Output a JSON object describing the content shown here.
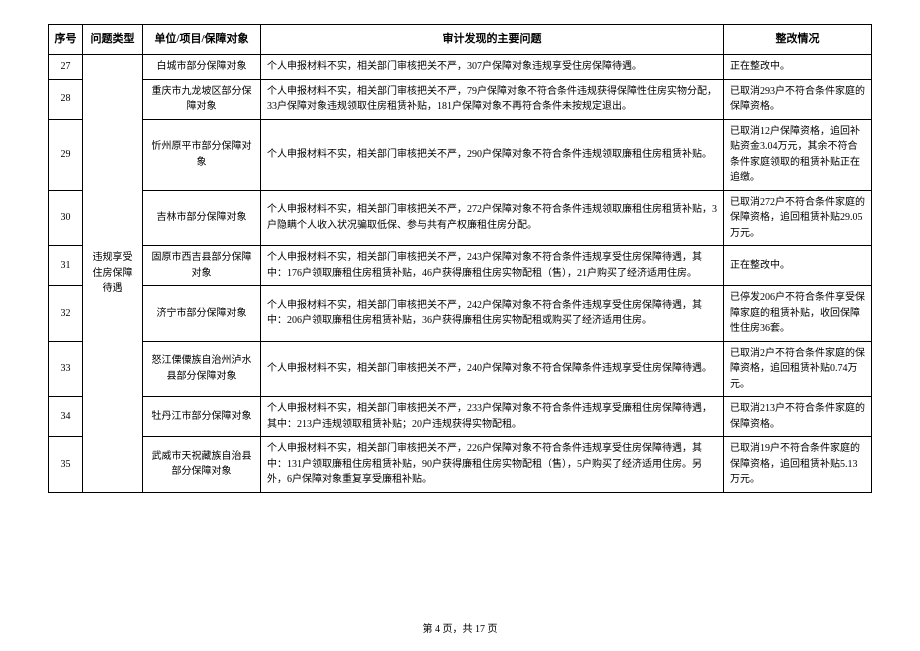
{
  "headers": {
    "seq": "序号",
    "category": "问题类型",
    "unit": "单位/项目/保障对象",
    "issue": "审计发现的主要问题",
    "status": "整改情况"
  },
  "category": "违规享受住房保障待遇",
  "rows": [
    {
      "seq": "27",
      "unit": "白城市部分保障对象",
      "issue": "个人申报材料不实，相关部门审核把关不严，307户保障对象违规享受住房保障待遇。",
      "status": "正在整改中。"
    },
    {
      "seq": "28",
      "unit": "重庆市九龙坡区部分保障对象",
      "issue": "个人申报材料不实，相关部门审核把关不严，79户保障对象不符合条件违规获得保障性住房实物分配，33户保障对象违规领取住房租赁补贴，181户保障对象不再符合条件未按规定退出。",
      "status": "已取消293户不符合条件家庭的保障资格。"
    },
    {
      "seq": "29",
      "unit": "忻州原平市部分保障对象",
      "issue": "个人申报材料不实，相关部门审核把关不严，290户保障对象不符合条件违规领取廉租住房租赁补贴。",
      "status": "已取消12户保障资格，追回补贴资金3.04万元，其余不符合条件家庭领取的租赁补贴正在追缴。"
    },
    {
      "seq": "30",
      "unit": "吉林市部分保障对象",
      "issue": "个人申报材料不实，相关部门审核把关不严，272户保障对象不符合条件违规领取廉租住房租赁补贴，3户隐瞒个人收入状况骗取低保、参与共有产权廉租住房分配。",
      "status": "已取消272户不符合条件家庭的保障资格，追回租赁补贴29.05万元。"
    },
    {
      "seq": "31",
      "unit": "固原市西吉县部分保障对象",
      "issue": "个人申报材料不实，相关部门审核把关不严，243户保障对象不符合条件违规享受住房保障待遇，其中：176户领取廉租住房租赁补贴，46户获得廉租住房实物配租（售），21户购买了经济适用住房。",
      "status": "正在整改中。"
    },
    {
      "seq": "32",
      "unit": "济宁市部分保障对象",
      "issue": "个人申报材料不实，相关部门审核把关不严，242户保障对象不符合条件违规享受住房保障待遇，其中：206户领取廉租住房租赁补贴，36户获得廉租住房实物配租或购买了经济适用住房。",
      "status": "已停发206户不符合条件享受保障家庭的租赁补贴，收回保障性住房36套。"
    },
    {
      "seq": "33",
      "unit": "怒江傈僳族自治州泸水县部分保障对象",
      "issue": "个人申报材料不实，相关部门审核把关不严，240户保障对象不符合保障条件违规享受住房保障待遇。",
      "status": "已取消2户不符合条件家庭的保障资格，追回租赁补贴0.74万元。"
    },
    {
      "seq": "34",
      "unit": "牡丹江市部分保障对象",
      "issue": "个人申报材料不实，相关部门审核把关不严，233户保障对象不符合条件违规享受廉租住房保障待遇，其中：213户违规领取租赁补贴；20户违规获得实物配租。",
      "status": "已取消213户不符合条件家庭的保障资格。"
    },
    {
      "seq": "35",
      "unit": "武威市天祝藏族自治县部分保障对象",
      "issue": "个人申报材料不实，相关部门审核把关不严，226户保障对象不符合条件违规享受住房保障待遇，其中：131户领取廉租住房租赁补贴，90户获得廉租住房实物配租（售），5户购买了经济适用住房。另外，6户保障对象重复享受廉租补贴。",
      "status": "已取消19户不符合条件家庭的保障资格，追回租赁补贴5.13万元。"
    }
  ],
  "footer": "第 4 页，共 17 页"
}
